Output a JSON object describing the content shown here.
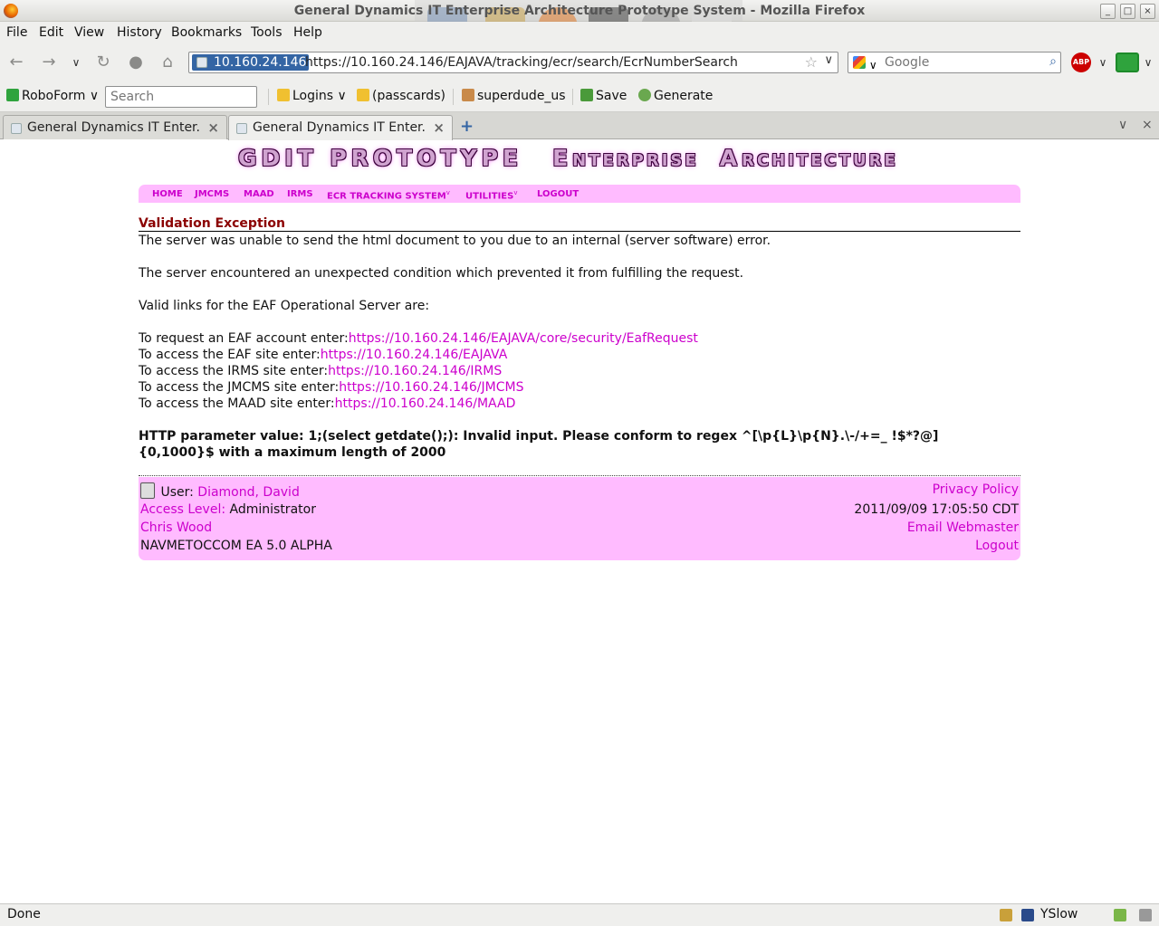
{
  "window": {
    "title": "General Dynamics IT Enterprise Architecture Prototype System - Mozilla Firefox",
    "minimize": "_",
    "maximize": "□",
    "close": "×"
  },
  "menu": [
    "File",
    "Edit",
    "View",
    "History",
    "Bookmarks",
    "Tools",
    "Help"
  ],
  "navbar": {
    "site_identity": "10.160.24.146",
    "url": "https://10.160.24.146/EAJAVA/tracking/ecr/search/EcrNumberSearch",
    "search_placeholder": "Google",
    "abp_label": "ABP"
  },
  "bookmarks": {
    "roboform": "RoboForm",
    "search_placeholder": "Search",
    "logins": "Logins",
    "passcards": "(passcards)",
    "identity": "superdude_us",
    "save": "Save",
    "generate": "Generate"
  },
  "tabs": [
    {
      "label": "General Dynamics IT Enter..."
    },
    {
      "label": "General Dynamics IT Enter..."
    }
  ],
  "page": {
    "banner_big": "GDIT PROTOTYPE",
    "banner_e": "E",
    "banner_nterprise": "NTERPRISE",
    "banner_a": "A",
    "banner_rchitecture": "RCHITECTURE",
    "nav": [
      "HOME",
      "JMCMS",
      "MAAD",
      "IRMS",
      "ECR TRACKING SYSTEM",
      "UTILITIES",
      "LOGOUT"
    ],
    "nav_dropdown_mark": "v",
    "error_title": "Validation Exception",
    "msg1": "The server was unable to send the html document to you due to an internal (server software) error.",
    "msg2": "The server encountered an unexpected condition which prevented it from fulfilling the request.",
    "msg3": "Valid links for the EAF Operational Server are:",
    "links": [
      {
        "prefix": "To request an EAF account enter:",
        "url": "https://10.160.24.146/EAJAVA/core/security/EafRequest"
      },
      {
        "prefix": "To access the EAF site enter:",
        "url": "https://10.160.24.146/EAJAVA"
      },
      {
        "prefix": "To access the IRMS site enter:",
        "url": "https://10.160.24.146/IRMS"
      },
      {
        "prefix": "To access the JMCMS site enter:",
        "url": "https://10.160.24.146/JMCMS"
      },
      {
        "prefix": "To access the MAAD site enter:",
        "url": "https://10.160.24.146/MAAD"
      }
    ],
    "http_error_line1": "HTTP parameter value: 1;(select getdate();): Invalid input. Please conform to regex ^[\\p{L}\\p{N}.\\-/+=_ !$*?@]",
    "http_error_line2": "{0,1000}$ with a maximum length of 2000"
  },
  "footer": {
    "user_label": "User:",
    "user_name": "Diamond, David",
    "access_label": "Access Level:",
    "access_value": "Administrator",
    "contact": "Chris Wood",
    "version": "NAVMETOCCOM EA 5.0 ALPHA",
    "privacy": "Privacy Policy",
    "timestamp": "2011/09/09 17:05:50 CDT",
    "email": "Email Webmaster",
    "logout": "Logout"
  },
  "statusbar": {
    "status": "Done",
    "yslow": "YSlow"
  },
  "colors": {
    "accent_pink": "#cc00cc",
    "nav_bg": "#ffbbff",
    "error_title": "#8b0000"
  }
}
